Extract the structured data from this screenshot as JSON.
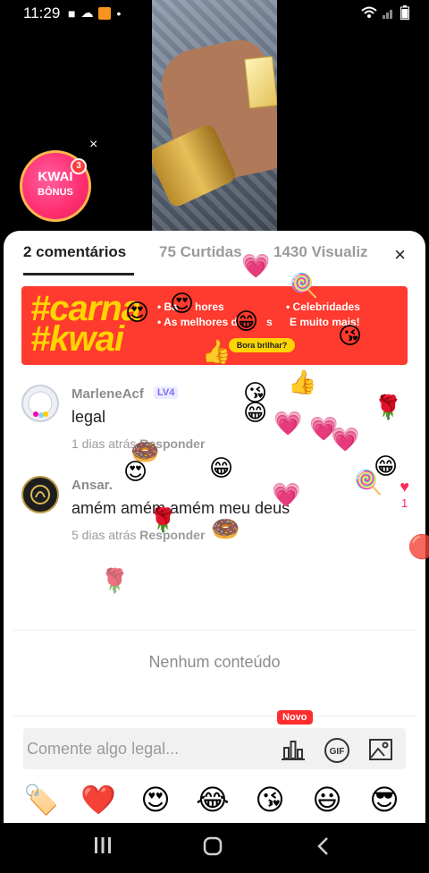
{
  "status_bar": {
    "time": "11:29",
    "left_icons": [
      "video-icon",
      "cloud-icon",
      "app-icon",
      "dot"
    ],
    "right_icons": [
      "wifi-icon",
      "signal-icon",
      "battery-icon"
    ]
  },
  "kwai_bonus": {
    "title": "KWAI",
    "subtitle": "BÔNUS",
    "badge": "3",
    "close": "×"
  },
  "tabs": [
    {
      "label": "2 comentários",
      "active": true
    },
    {
      "label": "75 Curtidas",
      "active": false
    },
    {
      "label": "1430 Visualiz",
      "active": false
    }
  ],
  "close_label": "×",
  "banner": {
    "hashtag_line1": "#carna",
    "hashtag_line2": "#kwai",
    "bullet1a": "• Ba",
    "bullet1b": "hores",
    "bullet2": "• As melhores d",
    "bullet2b": "s",
    "bullet3": "• Celebridades",
    "bullet4": "E muito mais!",
    "cta": "Bora brilhar?"
  },
  "comments": [
    {
      "name": "MarleneAcf",
      "level": "LV4",
      "text": "legal",
      "time": "1 dias atrás",
      "reply": "Responder",
      "likes": ""
    },
    {
      "name": "Ansar.",
      "level": "",
      "text": "amém amém amém meu deus",
      "time": "5 dias atrás",
      "reply": "Responder",
      "likes": "1"
    }
  ],
  "empty_text": "Nenhum conteúdo",
  "input": {
    "placeholder": "Comente algo legal...",
    "new_badge": "Novo",
    "gif_label": "GIF"
  },
  "emojis": [
    "🏷️",
    "❤️",
    "😍",
    "😂",
    "😘",
    "😃",
    "😎"
  ],
  "colors": {
    "accent": "#ff2d55",
    "banner_red": "#ff3a2e",
    "banner_yellow": "#ffd400",
    "level_purple": "#7a6cff"
  }
}
